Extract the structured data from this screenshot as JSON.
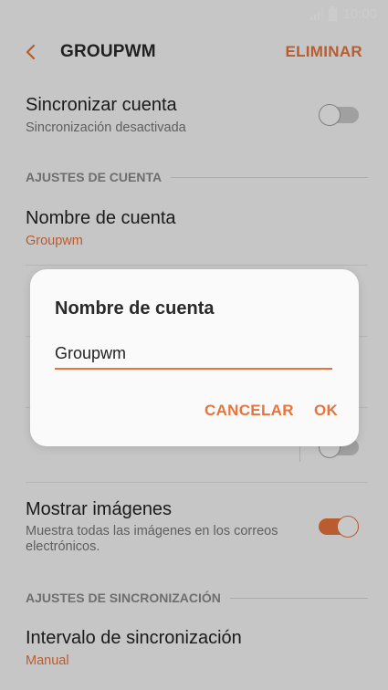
{
  "status": {
    "time": "10:00"
  },
  "header": {
    "title": "GROUPWM",
    "action": "ELIMINAR"
  },
  "settings": {
    "sync_account": {
      "title": "Sincronizar cuenta",
      "subtitle": "Sincronización desactivada",
      "enabled": false
    },
    "section_account": "AJUSTES DE CUENTA",
    "account_name": {
      "title": "Nombre de cuenta",
      "value": "Groupwm"
    },
    "show_images": {
      "title": "Mostrar imágenes",
      "subtitle": "Muestra todas las imágenes en los correos electrónicos.",
      "enabled": true
    },
    "section_sync": "AJUSTES DE SINCRONIZACIÓN",
    "sync_interval": {
      "title": "Intervalo de sincronización",
      "value": "Manual"
    }
  },
  "dialog": {
    "title": "Nombre de cuenta",
    "input_value": "Groupwm",
    "cancel": "CANCELAR",
    "ok": "OK"
  },
  "colors": {
    "accent": "#e8743b",
    "background": "#f8f8f8"
  },
  "icons": {
    "back": "chevron-left-icon",
    "signal": "signal-icon",
    "battery": "battery-icon"
  }
}
